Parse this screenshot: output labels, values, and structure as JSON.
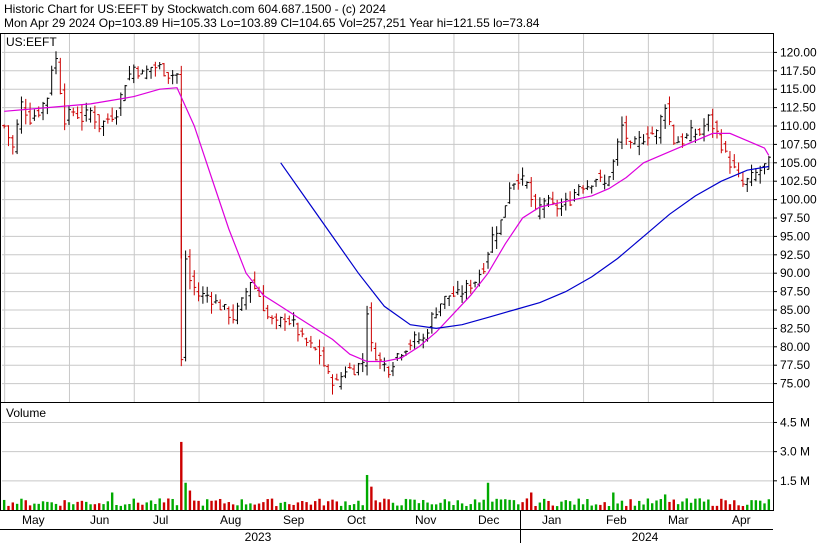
{
  "header": {
    "line1": "Historic Chart for US:EEFT by Stockwatch.com 604.687.1500 - (c) 2024",
    "line2": "Mon Apr 29 2024   Op=103.89   Hi=105.33   Lo=103.89   Cl=104.65   Vol=257,251   Year hi=121.55   lo=73.84"
  },
  "colors": {
    "up_bar": "#000000",
    "down_bar": "#cc0000",
    "ma_short": "#dd00dd",
    "ma_long": "#0000cc",
    "vol_up": "#00aa00",
    "vol_down": "#cc0000",
    "grid": "#c8c8c8"
  },
  "chart_data": [
    {
      "type": "ohlc",
      "symbol_label": "US:EEFT",
      "ylim": [
        72.5,
        122.5
      ],
      "grid": true,
      "yticks": [
        120.0,
        117.5,
        115.0,
        112.5,
        110.0,
        107.5,
        105.0,
        102.5,
        100.0,
        97.5,
        95.0,
        92.5,
        90.0,
        87.5,
        85.0,
        82.5,
        80.0,
        77.5,
        75.0
      ],
      "ytick_labels": [
        "120.00",
        "117.50",
        "115.00",
        "112.50",
        "110.00",
        "107.50",
        "105.00",
        "102.50",
        "100.00",
        "97.50",
        "95.00",
        "92.50",
        "90.00",
        "87.50",
        "85.00",
        "82.50",
        "80.00",
        "77.50",
        "75.00"
      ],
      "close_path": [
        [
          0,
          110
        ],
        [
          2,
          107
        ],
        [
          4,
          113
        ],
        [
          6,
          111
        ],
        [
          8,
          112
        ],
        [
          10,
          114
        ],
        [
          11,
          118
        ],
        [
          12,
          119
        ],
        [
          14,
          111
        ],
        [
          16,
          112
        ],
        [
          18,
          111
        ],
        [
          20,
          112
        ],
        [
          22,
          110
        ],
        [
          24,
          111
        ],
        [
          26,
          112
        ],
        [
          28,
          116
        ],
        [
          30,
          118
        ],
        [
          32,
          117
        ],
        [
          34,
          118
        ],
        [
          36,
          118
        ],
        [
          38,
          117
        ],
        [
          40,
          117
        ],
        [
          41,
          78
        ],
        [
          42,
          92
        ],
        [
          43,
          89
        ],
        [
          45,
          87
        ],
        [
          47,
          87
        ],
        [
          49,
          86
        ],
        [
          51,
          85
        ],
        [
          53,
          84
        ],
        [
          55,
          86
        ],
        [
          57,
          89
        ],
        [
          59,
          87
        ],
        [
          61,
          84
        ],
        [
          63,
          83
        ],
        [
          65,
          84
        ],
        [
          67,
          83
        ],
        [
          69,
          81
        ],
        [
          71,
          80
        ],
        [
          73,
          79
        ],
        [
          75,
          76
        ],
        [
          77,
          75
        ],
        [
          79,
          77
        ],
        [
          81,
          77
        ],
        [
          83,
          78
        ],
        [
          84,
          85
        ],
        [
          85,
          80
        ],
        [
          87,
          78
        ],
        [
          89,
          77
        ],
        [
          91,
          79
        ],
        [
          93,
          80
        ],
        [
          95,
          81
        ],
        [
          97,
          81
        ],
        [
          99,
          84
        ],
        [
          101,
          86
        ],
        [
          103,
          87
        ],
        [
          105,
          87
        ],
        [
          107,
          88
        ],
        [
          109,
          89
        ],
        [
          111,
          91
        ],
        [
          113,
          95
        ],
        [
          115,
          97
        ],
        [
          117,
          102
        ],
        [
          119,
          103
        ],
        [
          121,
          102
        ],
        [
          123,
          98
        ],
        [
          125,
          100
        ],
        [
          127,
          99
        ],
        [
          129,
          99
        ],
        [
          131,
          100
        ],
        [
          133,
          102
        ],
        [
          135,
          102
        ],
        [
          137,
          103
        ],
        [
          139,
          102
        ],
        [
          141,
          105
        ],
        [
          143,
          110
        ],
        [
          145,
          107
        ],
        [
          147,
          108
        ],
        [
          149,
          109
        ],
        [
          151,
          109
        ],
        [
          153,
          113
        ],
        [
          155,
          108
        ],
        [
          157,
          108
        ],
        [
          159,
          109
        ],
        [
          161,
          109
        ],
        [
          163,
          111
        ],
        [
          165,
          109
        ],
        [
          167,
          106
        ],
        [
          169,
          104
        ],
        [
          171,
          102
        ],
        [
          173,
          103
        ],
        [
          175,
          104
        ],
        [
          177,
          105
        ]
      ],
      "ma_short": [
        [
          0,
          112
        ],
        [
          10,
          112.5
        ],
        [
          20,
          113
        ],
        [
          30,
          114
        ],
        [
          36,
          115
        ],
        [
          40,
          115.2
        ],
        [
          44,
          110
        ],
        [
          48,
          103
        ],
        [
          52,
          96
        ],
        [
          56,
          90
        ],
        [
          60,
          87
        ],
        [
          64,
          85.5
        ],
        [
          68,
          84
        ],
        [
          72,
          82.5
        ],
        [
          76,
          81
        ],
        [
          80,
          79
        ],
        [
          84,
          78
        ],
        [
          88,
          78
        ],
        [
          92,
          78.5
        ],
        [
          96,
          80
        ],
        [
          100,
          82
        ],
        [
          104,
          84.5
        ],
        [
          108,
          87
        ],
        [
          112,
          90
        ],
        [
          116,
          94
        ],
        [
          120,
          97.5
        ],
        [
          124,
          99
        ],
        [
          128,
          99.5
        ],
        [
          132,
          100
        ],
        [
          136,
          100.5
        ],
        [
          140,
          101.5
        ],
        [
          144,
          103
        ],
        [
          148,
          105
        ],
        [
          152,
          106
        ],
        [
          156,
          107
        ],
        [
          160,
          108
        ],
        [
          164,
          109
        ],
        [
          168,
          109
        ],
        [
          172,
          108
        ],
        [
          176,
          107
        ],
        [
          177,
          106
        ]
      ],
      "ma_long": [
        [
          64,
          105
        ],
        [
          70,
          100
        ],
        [
          76,
          95
        ],
        [
          82,
          90
        ],
        [
          88,
          85.5
        ],
        [
          94,
          83
        ],
        [
          100,
          82.5
        ],
        [
          106,
          83
        ],
        [
          112,
          84
        ],
        [
          118,
          85
        ],
        [
          124,
          86
        ],
        [
          130,
          87.5
        ],
        [
          136,
          89.5
        ],
        [
          142,
          92
        ],
        [
          148,
          95
        ],
        [
          154,
          98
        ],
        [
          160,
          100.5
        ],
        [
          166,
          102.5
        ],
        [
          172,
          104
        ],
        [
          177,
          104.5
        ]
      ],
      "x_axis": {
        "months": [
          "May",
          "Jun",
          "Jul",
          "Aug",
          "Sep",
          "Oct",
          "Nov",
          "Dec",
          "Jan",
          "Feb",
          "Mar",
          "Apr"
        ],
        "years": [
          "2023",
          "2024"
        ]
      }
    },
    {
      "type": "bar",
      "title": "Volume",
      "ylim": [
        0,
        5.5
      ],
      "yticks": [
        1.5,
        3.0,
        4.5
      ],
      "ytick_labels": [
        "1.5 M",
        "3.0 M",
        "4.5 M"
      ],
      "typical_volume": 0.4,
      "spikes": [
        [
          41,
          3.5
        ],
        [
          42,
          1.4
        ],
        [
          43,
          1.0
        ],
        [
          25,
          0.9
        ],
        [
          84,
          1.8
        ],
        [
          85,
          1.2
        ],
        [
          112,
          1.4
        ],
        [
          122,
          0.9
        ],
        [
          141,
          0.9
        ],
        [
          153,
          0.8
        ],
        [
          161,
          0.6
        ],
        [
          167,
          0.5
        ]
      ]
    }
  ]
}
